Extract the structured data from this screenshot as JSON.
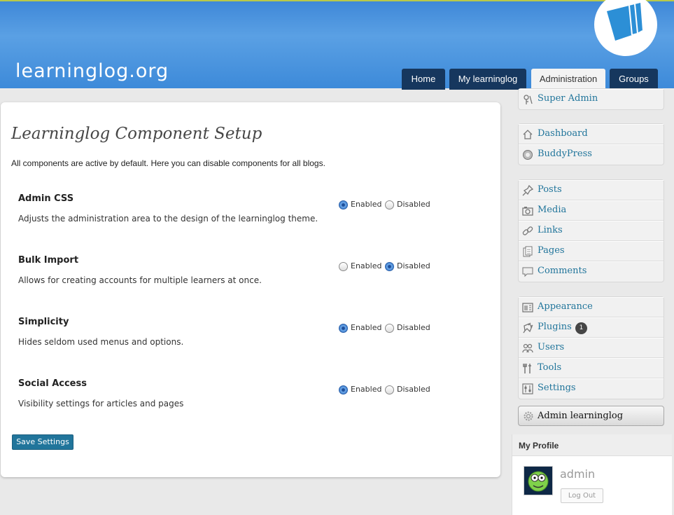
{
  "header": {
    "logo_text": "learninglog.org",
    "tabs": [
      {
        "label": "Home",
        "active": false
      },
      {
        "label": "My learninglog",
        "active": false
      },
      {
        "label": "Administration",
        "active": true
      },
      {
        "label": "Groups",
        "active": false
      }
    ]
  },
  "main": {
    "title": "Learninglog Component Setup",
    "intro": "All components are active by default. Here you can disable components for all blogs.",
    "enabled_label": "Enabled",
    "disabled_label": "Disabled",
    "components": [
      {
        "title": "Admin CSS",
        "description": "Adjusts the administration area to the design of the learninglog theme.",
        "value": "Enabled"
      },
      {
        "title": "Bulk Import",
        "description": "Allows for creating accounts for multiple learners at once.",
        "value": "Disabled"
      },
      {
        "title": "Simplicity",
        "description": "Hides seldom used menus and options.",
        "value": "Enabled"
      },
      {
        "title": "Social Access",
        "description": "Visibility settings for articles and pages",
        "value": "Enabled"
      }
    ],
    "save_label": "Save Settings"
  },
  "sidebar": {
    "groups": [
      [
        {
          "label": "Super Admin",
          "icon": "super-admin-icon"
        }
      ],
      [
        {
          "label": "Dashboard",
          "icon": "home-icon"
        },
        {
          "label": "BuddyPress",
          "icon": "buddypress-icon"
        }
      ],
      [
        {
          "label": "Posts",
          "icon": "pin-icon"
        },
        {
          "label": "Media",
          "icon": "camera-icon"
        },
        {
          "label": "Links",
          "icon": "link-icon"
        },
        {
          "label": "Pages",
          "icon": "pages-icon"
        },
        {
          "label": "Comments",
          "icon": "comment-icon"
        }
      ],
      [
        {
          "label": "Appearance",
          "icon": "appearance-icon"
        },
        {
          "label": "Plugins",
          "icon": "plug-icon",
          "badge": "1"
        },
        {
          "label": "Users",
          "icon": "users-icon"
        },
        {
          "label": "Tools",
          "icon": "tools-icon"
        },
        {
          "label": "Settings",
          "icon": "settings-icon"
        }
      ]
    ],
    "admin_button_label": "Admin learninglog"
  },
  "profile": {
    "heading": "My Profile",
    "username": "admin",
    "logout_label": "Log Out"
  },
  "colors": {
    "header_blue": "#4a94de",
    "tab_dark": "#16375e",
    "link": "#21759b",
    "button": "#21759b"
  }
}
